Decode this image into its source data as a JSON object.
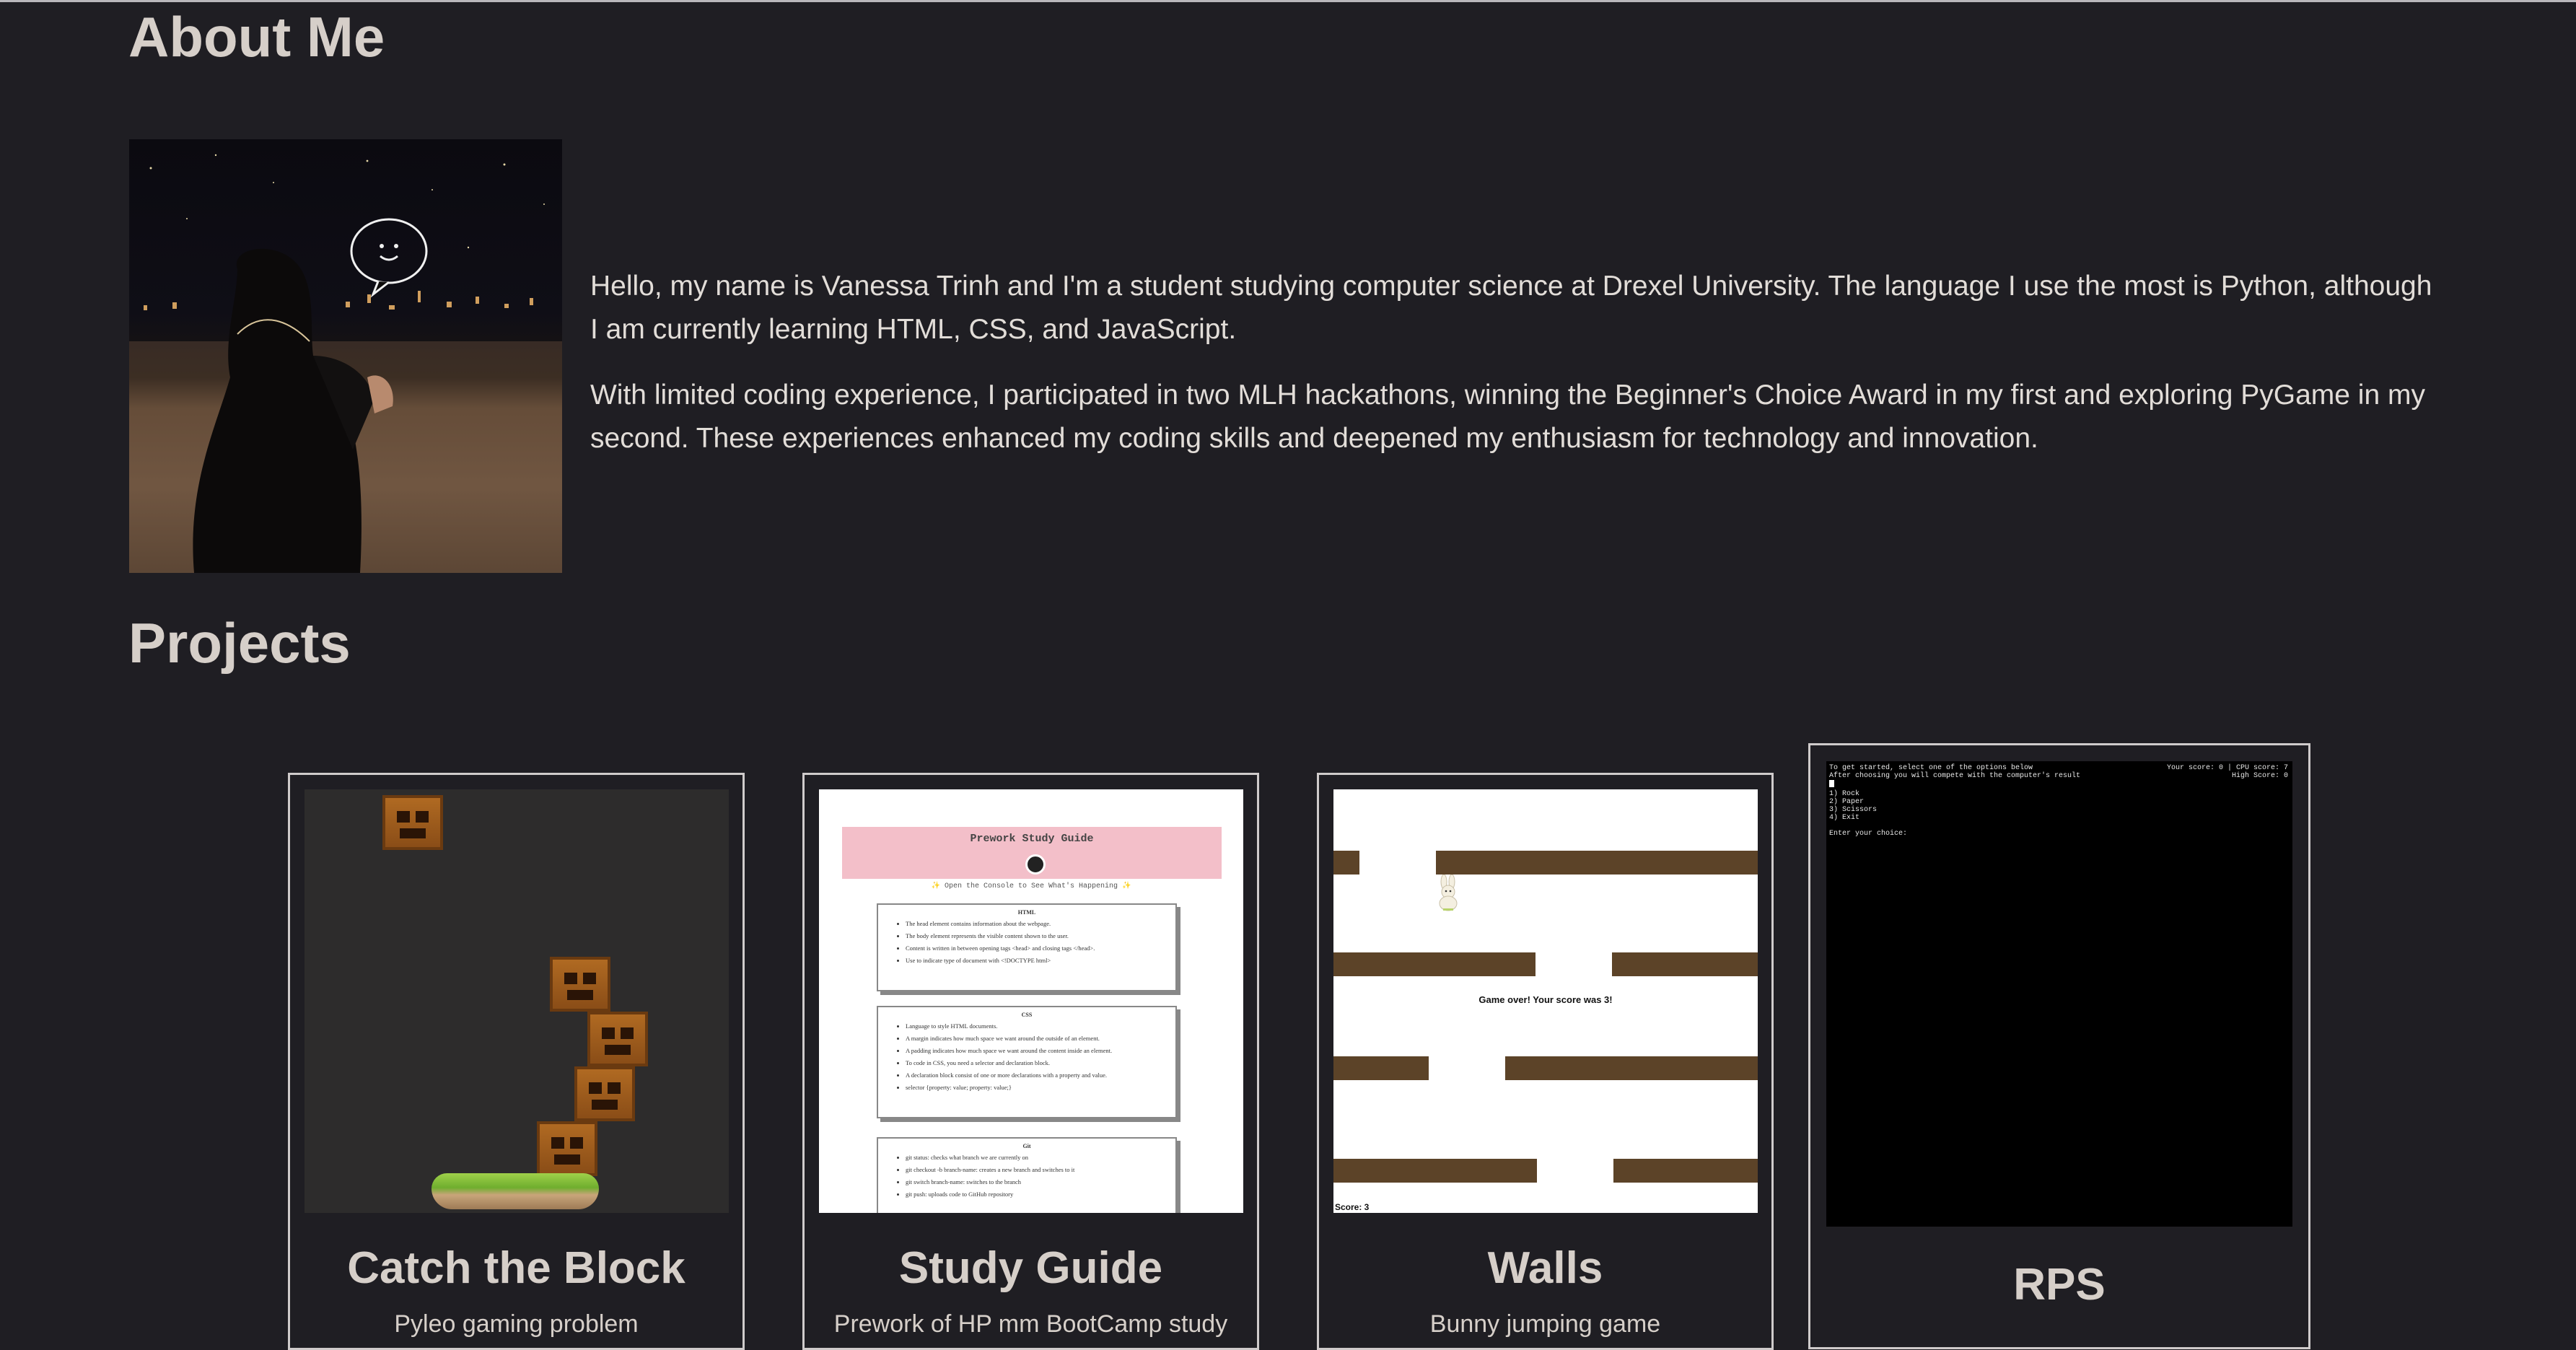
{
  "about": {
    "title": "About Me",
    "bio_1": "Hello, my name is Vanessa Trinh and I'm a student studying computer science at Drexel University. The language I use the most is Python, although I am currently learning HTML, CSS, and JavaScript.",
    "bio_2": "With limited coding experience, I participated in two MLH hackathons, winning the Beginner's Choice Award in my first and exploring PyGame in my second. These experiences enhanced my coding skills and deepened my enthusiasm for technology and innovation."
  },
  "projects": {
    "title": "Projects",
    "cards": [
      {
        "title": "Catch the Block",
        "desc": "Pyleo gaming problem"
      },
      {
        "title": "Study Guide",
        "desc": "Prework of HP mm BootCamp study"
      },
      {
        "title": "Walls",
        "desc": "Bunny jumping game"
      },
      {
        "title": "RPS"
      }
    ]
  },
  "study_guide": {
    "heading": "Prework Study Guide",
    "subtitle": "✨ Open the Console to See What's Happening ✨",
    "sections": [
      {
        "name": "HTML",
        "items": [
          "The head element contains information about the webpage.",
          "The body element represents the visible content shown to the user.",
          "Content is written in between opening tags <head> and closing tags </head>.",
          "Use to indicate type of document with <!DOCTYPE html>"
        ]
      },
      {
        "name": "CSS",
        "items": [
          "Language to style HTML documents.",
          "A margin indicates how much space we want around the outside of an element.",
          "A padding indicates how much space we want around the content inside an element.",
          "To code in CSS, you need a selector and declaration block.",
          "A declaration block consist of one or more declarations with a property and value.",
          "selector {property: value; property: value;}"
        ]
      },
      {
        "name": "Git",
        "items": [
          "git status: checks what branch we are currently on",
          "git checkout -b branch-name: creates a new branch and switches to it",
          "git switch branch-name: switches to the branch",
          "git push: uploads code to GitHub repository"
        ]
      }
    ]
  },
  "walls_game": {
    "message": "Game over! Your score was 3!",
    "score": "Score: 3"
  },
  "rps_game": {
    "left_text": "To get started, select one of the options below\nAfter choosing you will compete with the computer's result\n",
    "options": "1) Rock\n2) Paper\n3) Scissors\n4) Exit\n\nEnter your choice:",
    "right_text": "Your score: 0 | CPU score: 7\nHigh Score: 0"
  },
  "colors": {
    "background": "#1f1e23",
    "heading": "#d6cfc9",
    "card_border": "#cfcbcb",
    "wall": "#5c4328",
    "banner": "#f3bfc9"
  }
}
